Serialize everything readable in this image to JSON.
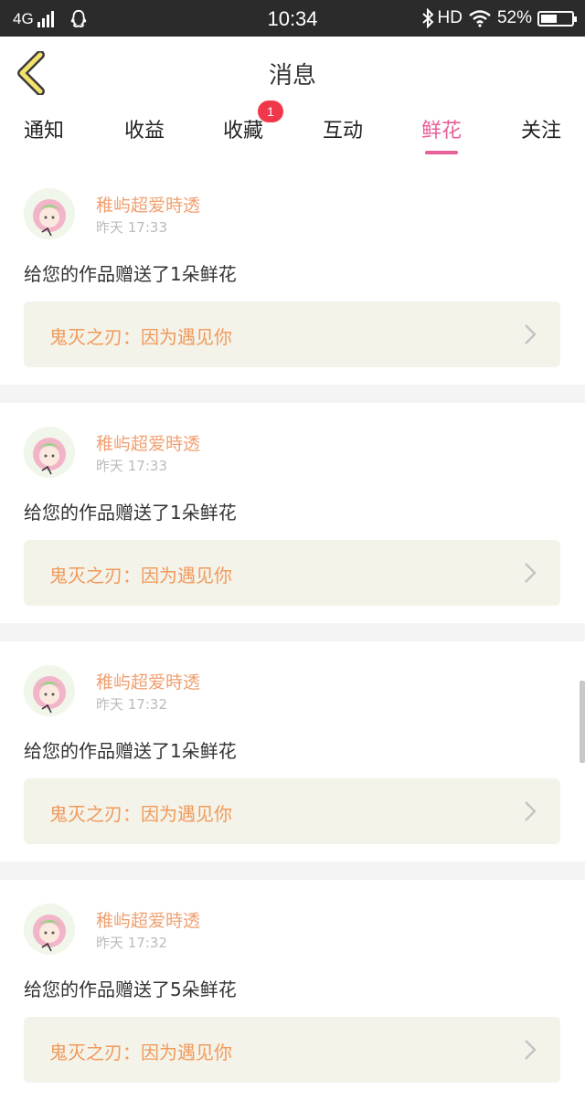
{
  "status_bar": {
    "network": "4G",
    "time": "10:34",
    "hd": "HD",
    "battery": "52%",
    "battery_level": 0.52
  },
  "nav": {
    "title": "消息",
    "back_icon": "chevron-left-icon"
  },
  "tabs": [
    {
      "label": "通知"
    },
    {
      "label": "收益"
    },
    {
      "label": "收藏",
      "badge": "1"
    },
    {
      "label": "互动"
    },
    {
      "label": "鲜花",
      "active": true
    },
    {
      "label": "关注"
    }
  ],
  "messages": [
    {
      "user": "稚屿超爱時透",
      "time": "昨天 17:33",
      "text": "给您的作品赠送了1朵鲜花",
      "work": "鬼灭之刃：因为遇见你"
    },
    {
      "user": "稚屿超爱時透",
      "time": "昨天 17:33",
      "text": "给您的作品赠送了1朵鲜花",
      "work": "鬼灭之刃：因为遇见你"
    },
    {
      "user": "稚屿超爱時透",
      "time": "昨天 17:32",
      "text": "给您的作品赠送了1朵鲜花",
      "work": "鬼灭之刃：因为遇见你"
    },
    {
      "user": "稚屿超爱時透",
      "time": "昨天 17:32",
      "text": "给您的作品赠送了5朵鲜花",
      "work": "鬼灭之刃：因为遇见你"
    }
  ],
  "colors": {
    "accent": "#e8609a",
    "username": "#f0a070",
    "work_title": "#f09a5a",
    "work_bg": "#f4f3ea",
    "badge": "#f0384a"
  }
}
